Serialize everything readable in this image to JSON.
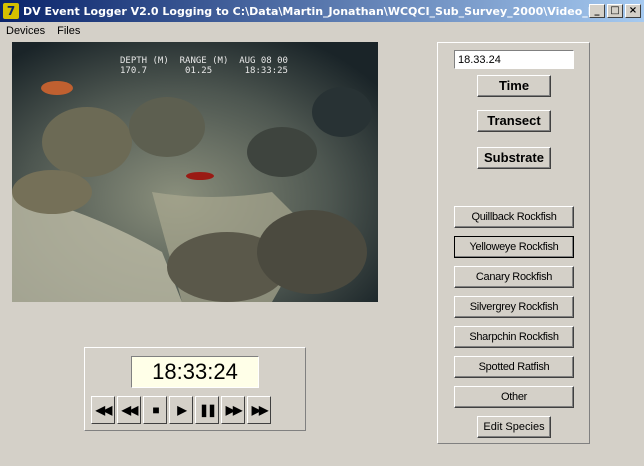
{
  "window": {
    "icon_glyph": "7",
    "title": "DV Event Logger V2.0    Logging to C:\\Data\\Martin_Jonathan\\WCQCI_Sub_Survey_2000\\Video_Lo...",
    "minimize": "_",
    "maximize": "□",
    "close": "×"
  },
  "menu": [
    "Devices",
    "Files"
  ],
  "video_overlay": {
    "line1": "DEPTH (M)  RANGE (M)  AUG 08 00",
    "line2": "170.7       01.25      18:33:25"
  },
  "playback": {
    "time": "18:33:24",
    "buttons": [
      {
        "name": "rewind-icon",
        "glyph": "◀◀"
      },
      {
        "name": "skip-back-icon",
        "glyph": "◀◀"
      },
      {
        "name": "stop-icon",
        "glyph": "■"
      },
      {
        "name": "play-icon",
        "glyph": "▶"
      },
      {
        "name": "pause-icon",
        "glyph": "❚❚"
      },
      {
        "name": "skip-forward-icon",
        "glyph": "▶▶"
      },
      {
        "name": "fast-forward-icon",
        "glyph": "▶▶"
      }
    ]
  },
  "logger": {
    "time_field": "18.33.24",
    "time_button": "Time",
    "transect_button": "Transect",
    "substrate_button": "Substrate",
    "species": [
      "Quillback Rockfish",
      "Yelloweye Rockfish",
      "Canary Rockfish",
      "Silvergrey Rockfish",
      "Sharpchin Rockfish",
      "Spotted Ratfish",
      "Other"
    ],
    "edit_species": "Edit Species"
  },
  "colors": {
    "title_start": "#0a246a",
    "title_end": "#a6caf0",
    "face": "#d4d0c8"
  }
}
